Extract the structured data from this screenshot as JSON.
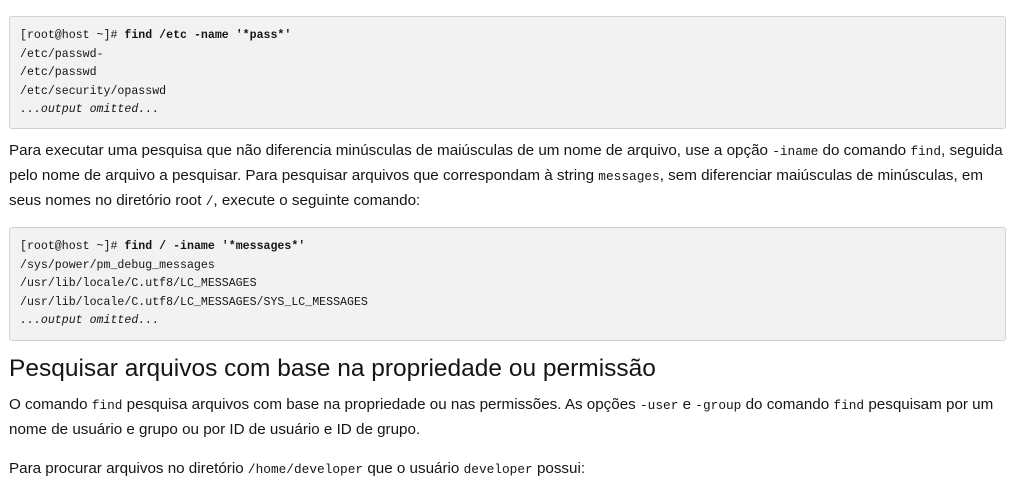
{
  "code_block_1": {
    "prompt": "[root@host ~]# ",
    "command": "find /etc -name '*pass*'",
    "output": [
      "/etc/passwd-",
      "/etc/passwd",
      "/etc/security/opasswd"
    ],
    "omitted": "...output omitted..."
  },
  "para_1": {
    "t1": "Para executar uma pesquisa que não diferencia minúsculas de maiúsculas de um nome de arquivo, use a opção ",
    "c1": "-iname",
    "t2": " do comando ",
    "c2": "find",
    "t3": ", seguida pelo nome de arquivo a pesquisar. Para pesquisar arquivos que correspondam à string ",
    "c3": "messages",
    "t4": ", sem diferenciar maiúsculas de minúsculas, em seus nomes no diretório root ",
    "c4": "/",
    "t5": ", execute o seguinte comando:"
  },
  "code_block_2": {
    "prompt": "[root@host ~]# ",
    "command": "find / -iname '*messages*'",
    "output": [
      "/sys/power/pm_debug_messages",
      "/usr/lib/locale/C.utf8/LC_MESSAGES",
      "/usr/lib/locale/C.utf8/LC_MESSAGES/SYS_LC_MESSAGES"
    ],
    "omitted": "...output omitted..."
  },
  "section_title": "Pesquisar arquivos com base na propriedade ou permissão",
  "para_2": {
    "t1": "O comando ",
    "c1": "find",
    "t2": " pesquisa arquivos com base na propriedade ou nas permissões. As opções ",
    "c2": "-user",
    "t3": " e ",
    "c3": "-group",
    "t4": " do comando ",
    "c4": "find",
    "t5": " pesquisam por um nome de usuário e grupo ou por ID de usuário e ID de grupo."
  },
  "para_3": {
    "t1": "Para procurar arquivos no diretório ",
    "c1": "/home/developer",
    "t2": " que o usuário ",
    "c2": "developer",
    "t3": " possui:"
  }
}
